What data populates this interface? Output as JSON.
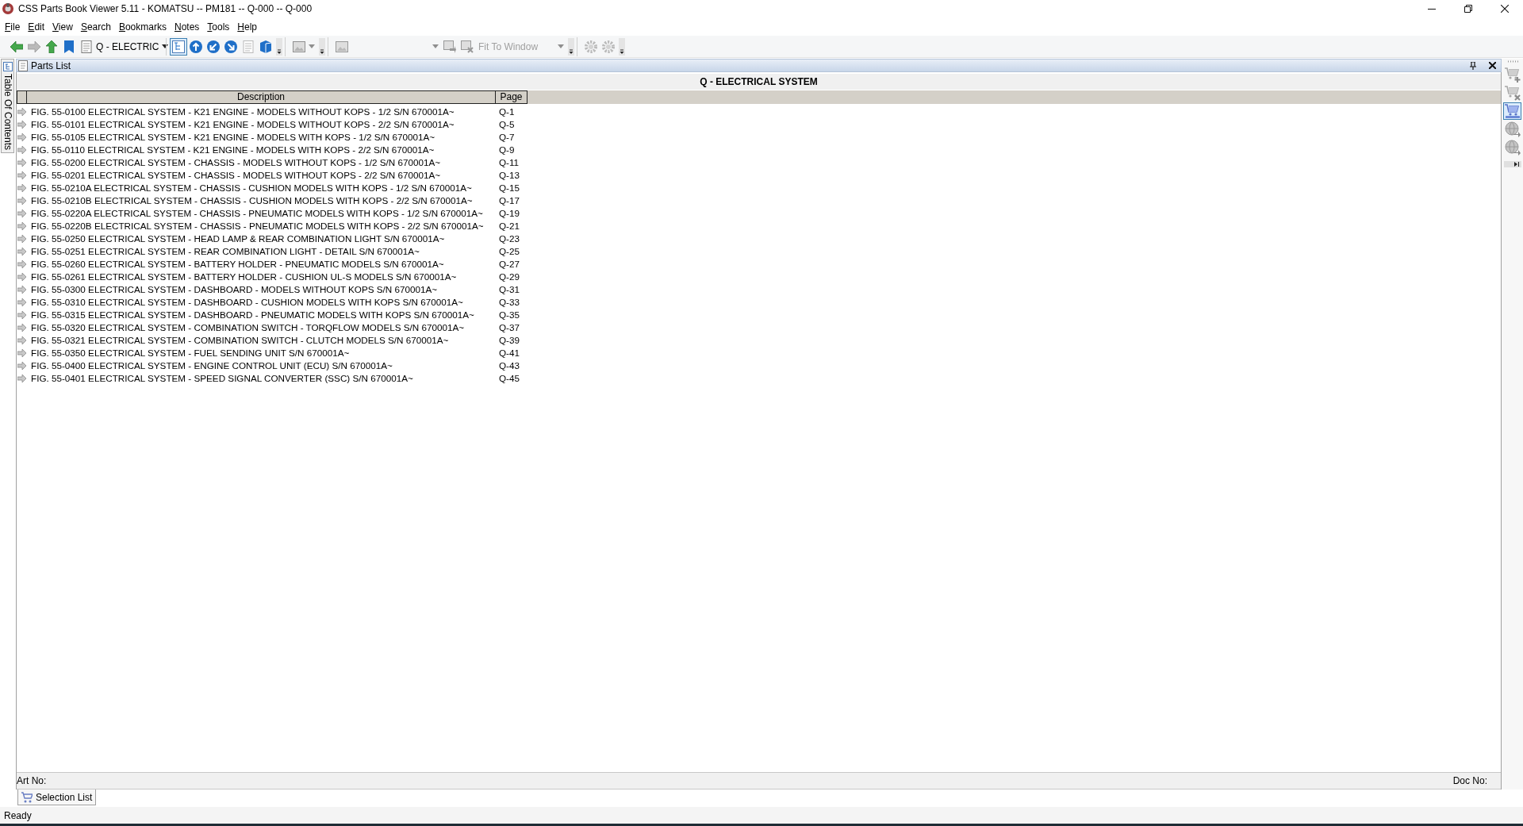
{
  "window": {
    "title": "CSS Parts Book Viewer 5.11 - KOMATSU -- PM181 -- Q-000 -- Q-000"
  },
  "menu": [
    "File",
    "Edit",
    "View",
    "Search",
    "Bookmarks",
    "Notes",
    "Tools",
    "Help"
  ],
  "toolbars": [
    {
      "items": [
        {
          "kind": "button",
          "disabled": false
        },
        {
          "kind": "button",
          "disabled": true
        },
        {
          "kind": "button",
          "disabled": false
        },
        {
          "kind": "button",
          "disabled": false
        },
        {
          "kind": "combo",
          "value": "Q - ELECTRIC",
          "disabled": false
        },
        {
          "kind": "toggle",
          "selected": true
        },
        {
          "kind": "button",
          "disabled": false
        },
        {
          "kind": "button",
          "disabled": false
        },
        {
          "kind": "button",
          "disabled": false
        },
        {
          "kind": "button",
          "disabled": true
        },
        {
          "kind": "button",
          "disabled": false
        }
      ]
    },
    {
      "items": [
        {
          "kind": "menu-button",
          "disabled": true
        }
      ]
    },
    {
      "items": [
        {
          "kind": "button",
          "disabled": true
        },
        {
          "kind": "combo",
          "disabled": true
        },
        {
          "kind": "button",
          "disabled": true
        },
        {
          "kind": "button",
          "disabled": true
        },
        {
          "kind": "combo",
          "value": "Fit To Window",
          "disabled": true
        }
      ]
    },
    {
      "items": [
        {
          "kind": "button",
          "disabled": true
        },
        {
          "kind": "button",
          "disabled": true
        }
      ]
    }
  ],
  "side_tabs": [
    {
      "label": "Table Of Contents"
    }
  ],
  "panel": {
    "title": "Parts List"
  },
  "parts_list": {
    "title": "Q - ELECTRICAL SYSTEM",
    "columns": [
      "Description",
      "Page"
    ],
    "rows": [
      {
        "description": "FIG. 55-0100 ELECTRICAL SYSTEM - K21 ENGINE - MODELS WITHOUT KOPS - 1/2 S/N 670001A~",
        "page": "Q-1"
      },
      {
        "description": "FIG. 55-0101 ELECTRICAL SYSTEM - K21 ENGINE - MODELS WITHOUT KOPS - 2/2 S/N 670001A~",
        "page": "Q-5"
      },
      {
        "description": "FIG. 55-0105 ELECTRICAL SYSTEM - K21 ENGINE - MODELS WITH KOPS - 1/2 S/N 670001A~",
        "page": "Q-7"
      },
      {
        "description": "FIG. 55-0110 ELECTRICAL SYSTEM - K21 ENGINE - MODELS WITH KOPS - 2/2 S/N 670001A~",
        "page": "Q-9"
      },
      {
        "description": "FIG. 55-0200 ELECTRICAL SYSTEM - CHASSIS - MODELS WITHOUT KOPS - 1/2 S/N 670001A~",
        "page": "Q-11"
      },
      {
        "description": "FIG. 55-0201 ELECTRICAL SYSTEM - CHASSIS - MODELS WITHOUT KOPS - 2/2 S/N 670001A~",
        "page": "Q-13"
      },
      {
        "description": "FIG. 55-0210A ELECTRICAL SYSTEM - CHASSIS - CUSHION MODELS WITH KOPS - 1/2 S/N 670001A~",
        "page": "Q-15"
      },
      {
        "description": "FIG. 55-0210B ELECTRICAL SYSTEM - CHASSIS - CUSHION MODELS WITH KOPS - 2/2 S/N 670001A~",
        "page": "Q-17"
      },
      {
        "description": "FIG. 55-0220A ELECTRICAL SYSTEM - CHASSIS - PNEUMATIC MODELS WITH KOPS - 1/2 S/N 670001A~",
        "page": "Q-19"
      },
      {
        "description": "FIG. 55-0220B ELECTRICAL SYSTEM - CHASSIS - PNEUMATIC MODELS WITH KOPS - 2/2 S/N 670001A~",
        "page": "Q-21"
      },
      {
        "description": "FIG. 55-0250 ELECTRICAL SYSTEM - HEAD LAMP & REAR COMBINATION LIGHT S/N 670001A~",
        "page": "Q-23"
      },
      {
        "description": "FIG. 55-0251 ELECTRICAL SYSTEM - REAR COMBINATION LIGHT - DETAIL S/N 670001A~",
        "page": "Q-25"
      },
      {
        "description": "FIG. 55-0260 ELECTRICAL SYSTEM - BATTERY HOLDER - PNEUMATIC MODELS S/N 670001A~",
        "page": "Q-27"
      },
      {
        "description": "FIG. 55-0261 ELECTRICAL SYSTEM - BATTERY HOLDER - CUSHION UL-S MODELS S/N 670001A~",
        "page": "Q-29"
      },
      {
        "description": "FIG. 55-0300 ELECTRICAL SYSTEM - DASHBOARD - MODELS WITHOUT KOPS S/N 670001A~",
        "page": "Q-31"
      },
      {
        "description": "FIG. 55-0310 ELECTRICAL SYSTEM - DASHBOARD - CUSHION MODELS WITH KOPS S/N 670001A~",
        "page": "Q-33"
      },
      {
        "description": "FIG. 55-0315 ELECTRICAL SYSTEM - DASHBOARD - PNEUMATIC MODELS WITH KOPS S/N 670001A~",
        "page": "Q-35"
      },
      {
        "description": "FIG. 55-0320 ELECTRICAL SYSTEM - COMBINATION SWITCH - TORQFLOW MODELS S/N 670001A~",
        "page": "Q-37"
      },
      {
        "description": "FIG. 55-0321 ELECTRICAL SYSTEM - COMBINATION SWITCH - CLUTCH MODELS S/N 670001A~",
        "page": "Q-39"
      },
      {
        "description": "FIG. 55-0350 ELECTRICAL SYSTEM - FUEL SENDING UNIT S/N 670001A~",
        "page": "Q-41"
      },
      {
        "description": "FIG. 55-0400 ELECTRICAL SYSTEM - ENGINE CONTROL UNIT (ECU) S/N 670001A~",
        "page": "Q-43"
      },
      {
        "description": "FIG. 55-0401 ELECTRICAL SYSTEM - SPEED SIGNAL CONVERTER (SSC) S/N 670001A~",
        "page": "Q-45"
      }
    ]
  },
  "info_bar": {
    "labels": [
      "Art No:",
      "Doc No:"
    ]
  },
  "bottom_tabs": [
    {
      "label": "Selection List",
      "selected": true
    }
  ],
  "right_toolbar": {
    "items": [
      {
        "disabled": true,
        "selected": false
      },
      {
        "disabled": true,
        "selected": false
      },
      {
        "disabled": false,
        "selected": true
      },
      {
        "disabled": true,
        "selected": false
      },
      {
        "disabled": true,
        "selected": false
      }
    ]
  },
  "status_bar": {
    "text": "Ready"
  }
}
